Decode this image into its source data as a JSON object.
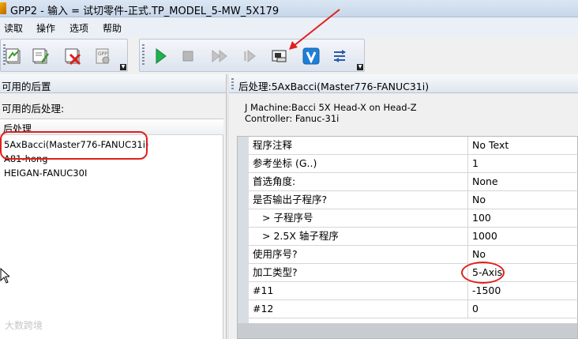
{
  "window": {
    "title": "GPP2 - 输入 = 试切零件-正式.TP_MODEL_5-MW_5X179"
  },
  "menu": {
    "items": [
      "读取",
      "操作",
      "选项",
      "帮助"
    ]
  },
  "toolbar": {
    "file_icons": [
      "load-post-icon",
      "edit-post-icon",
      "delete-post-icon",
      "gpp-icon"
    ],
    "run_icons": [
      "play-icon",
      "stop-icon",
      "fast-forward-icon",
      "step-icon",
      "machine-simulation-icon",
      "verify-icon",
      "output-icon"
    ],
    "colors": {
      "play": "#22b14c",
      "verify": "#1e7fd6",
      "annotation": "#e0201c"
    }
  },
  "left_panel": {
    "header": "可用的后置",
    "label": "可用的后处理:",
    "list_header": "后处理",
    "items": [
      "5AxBacci(Master776-FANUC31i)",
      "A81-hong",
      "HEIGAN-FANUC30I"
    ]
  },
  "right_panel": {
    "header": "后处理:5AxBacci(Master776-FANUC31i)",
    "machine_line": "J Machine:Bacci 5X Head-X on Head-Z",
    "controller_line": "Controller: Fanuc-31i",
    "rows": [
      {
        "name": "程序注释",
        "value": "No Text"
      },
      {
        "name": "参考坐标 (G..)",
        "value": "1"
      },
      {
        "name": "首选角度:",
        "value": "None"
      },
      {
        "name": "是否输出子程序?",
        "value": "No"
      },
      {
        "name": "> 子程序号",
        "value": "100"
      },
      {
        "name": "> 2.5X 轴子程序",
        "value": "1000"
      },
      {
        "name": "使用序号?",
        "value": "No"
      },
      {
        "name": "加工类型?",
        "value": "5-Axis"
      },
      {
        "name": "#11",
        "value": "-1500"
      },
      {
        "name": "#12",
        "value": "0"
      }
    ]
  },
  "watermark": "大数跨境"
}
